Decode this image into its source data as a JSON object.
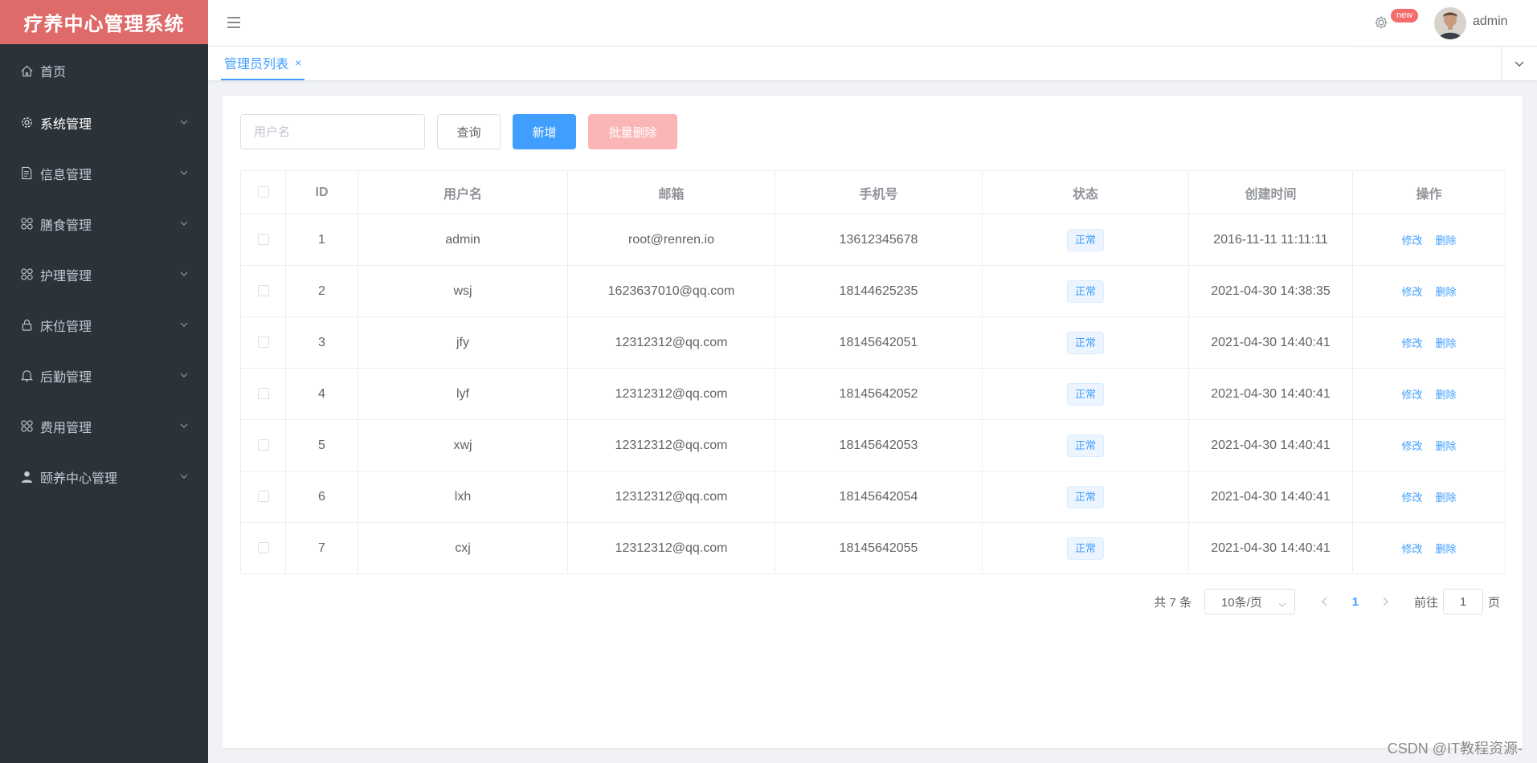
{
  "app": {
    "title": "疗养中心管理系统"
  },
  "sidebar": {
    "items": [
      {
        "label": "首页",
        "icon": "home-icon",
        "expandable": false
      },
      {
        "label": "系统管理",
        "icon": "gear-icon",
        "expandable": true,
        "active": true
      },
      {
        "label": "信息管理",
        "icon": "document-icon",
        "expandable": true
      },
      {
        "label": "膳食管理",
        "icon": "grid-icon",
        "expandable": true
      },
      {
        "label": "护理管理",
        "icon": "grid-icon",
        "expandable": true
      },
      {
        "label": "床位管理",
        "icon": "lock-icon",
        "expandable": true
      },
      {
        "label": "后勤管理",
        "icon": "bell-icon",
        "expandable": true
      },
      {
        "label": "费用管理",
        "icon": "grid-icon",
        "expandable": true
      },
      {
        "label": "颐养中心管理",
        "icon": "user-icon",
        "expandable": true
      }
    ]
  },
  "header": {
    "badge": "new",
    "username": "admin"
  },
  "tabs": [
    {
      "label": "管理员列表",
      "close": "×"
    }
  ],
  "toolbar": {
    "search_placeholder": "用户名",
    "search_value": "",
    "query_label": "查询",
    "add_label": "新增",
    "batch_delete_label": "批量删除"
  },
  "table": {
    "columns": [
      "ID",
      "用户名",
      "邮箱",
      "手机号",
      "状态",
      "创建时间",
      "操作"
    ],
    "rows": [
      {
        "id": "1",
        "username": "admin",
        "email": "root@renren.io",
        "phone": "13612345678",
        "status": "正常",
        "created": "2016-11-11 11:11:11"
      },
      {
        "id": "2",
        "username": "wsj",
        "email": "1623637010@qq.com",
        "phone": "18144625235",
        "status": "正常",
        "created": "2021-04-30 14:38:35"
      },
      {
        "id": "3",
        "username": "jfy",
        "email": "12312312@qq.com",
        "phone": "18145642051",
        "status": "正常",
        "created": "2021-04-30 14:40:41"
      },
      {
        "id": "4",
        "username": "lyf",
        "email": "12312312@qq.com",
        "phone": "18145642052",
        "status": "正常",
        "created": "2021-04-30 14:40:41"
      },
      {
        "id": "5",
        "username": "xwj",
        "email": "12312312@qq.com",
        "phone": "18145642053",
        "status": "正常",
        "created": "2021-04-30 14:40:41"
      },
      {
        "id": "6",
        "username": "lxh",
        "email": "12312312@qq.com",
        "phone": "18145642054",
        "status": "正常",
        "created": "2021-04-30 14:40:41"
      },
      {
        "id": "7",
        "username": "cxj",
        "email": "12312312@qq.com",
        "phone": "18145642055",
        "status": "正常",
        "created": "2021-04-30 14:40:41"
      }
    ],
    "edit_label": "修改",
    "delete_label": "删除"
  },
  "pagination": {
    "total_text": "共 7 条",
    "page_size": "10条/页",
    "current_page": "1",
    "goto_prefix": "前往",
    "goto_value": "1",
    "goto_suffix": "页"
  },
  "watermark": "CSDN @IT教程资源-",
  "colors": {
    "logo_bg": "#de6a6a",
    "sidebar_bg": "#2c3338",
    "primary": "#409eff",
    "danger_disabled": "#fab6b6"
  }
}
